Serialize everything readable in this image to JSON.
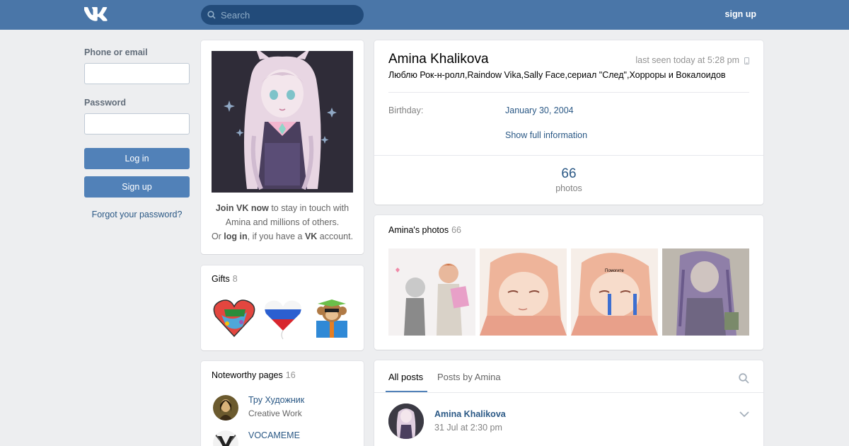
{
  "header": {
    "logo": "vk-logo",
    "search_placeholder": "Search",
    "signup_label": "sign up",
    "colors": {
      "bar": "#4a76a8",
      "search_bg": "#224b7a"
    }
  },
  "login": {
    "phone_label": "Phone or email",
    "password_label": "Password",
    "login_button": "Log in",
    "signup_button": "Sign up",
    "forgot_link": "Forgot your password?"
  },
  "avatar_block": {
    "join_strong": "Join VK now",
    "join_rest": " to stay in touch with Amina and millions of others.",
    "or": "Or ",
    "login_strong": "log in",
    "if_have": ", if you have a ",
    "vk": "VK",
    "account": " account."
  },
  "gifts": {
    "title": "Gifts",
    "count": "8",
    "items": [
      "heart-gift-icon",
      "russian-flag-heart-balloon-icon",
      "monkey-gift-box-icon"
    ]
  },
  "noteworthy": {
    "title": "Noteworthy pages",
    "count": "16",
    "items": [
      {
        "name": "Тру Художник",
        "sub": "Creative Work"
      },
      {
        "name": "VOCAMEME",
        "sub": ""
      }
    ]
  },
  "profile": {
    "name": "Amina Khalikova",
    "last_seen": "last seen today at 5:28 pm",
    "status": "Люблю Рок-н-ролл,Raindow Vika,Sally Face,сериал \"След\",Хорроры и Вокалоидов",
    "birthday_label": "Birthday:",
    "birthday_value": "January 30, 2004",
    "show_full": "Show full information",
    "photos_count": "66",
    "photos_label": "photos"
  },
  "photos": {
    "title": "Amina's photos",
    "count": "66",
    "thumb_text_3": "Помогите"
  },
  "posts": {
    "tab_all": "All posts",
    "tab_by": "Posts by Amina",
    "author": "Amina Khalikova",
    "date": "31 Jul at 2:30 pm"
  },
  "colors": {
    "link": "#2a5885",
    "button": "#5181b8",
    "bg": "#edeef0"
  }
}
